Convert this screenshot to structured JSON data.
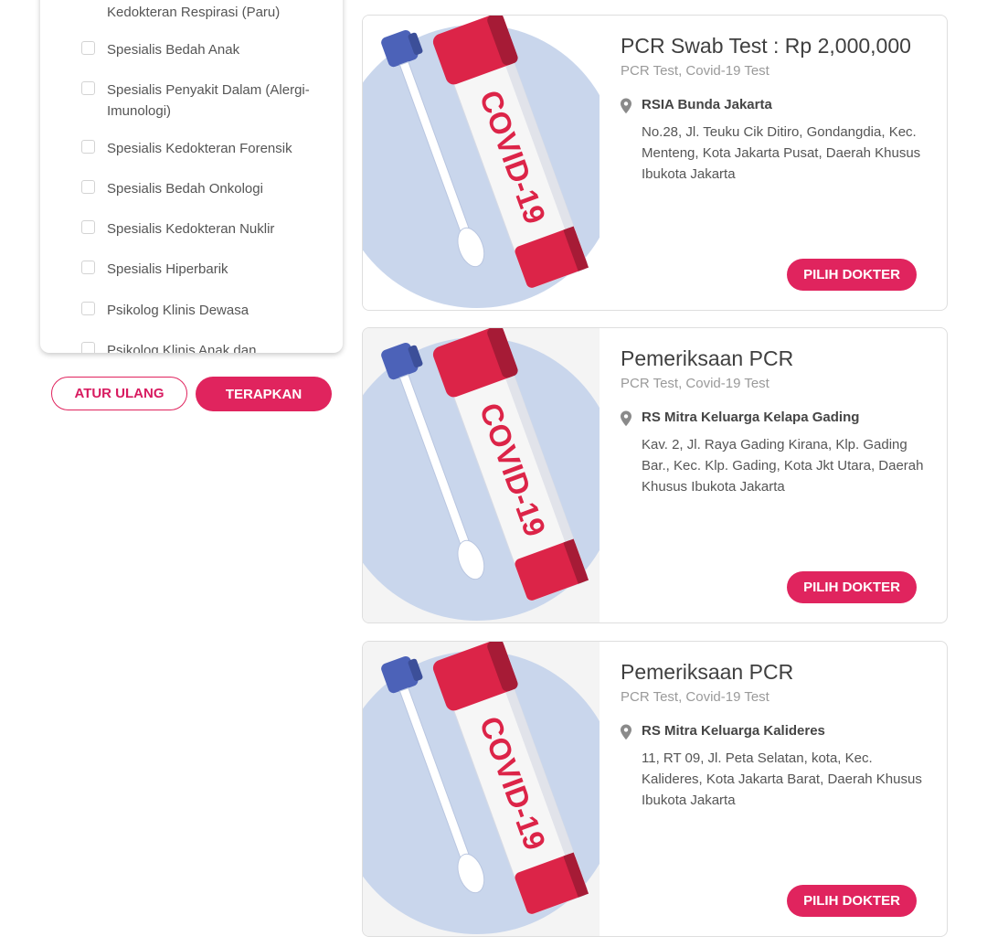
{
  "filters": {
    "specialties": [
      {
        "label": "Kedokteran Respirasi (Paru)",
        "checked": false
      },
      {
        "label": "Spesialis Bedah Anak",
        "checked": false
      },
      {
        "label": "Spesialis Penyakit Dalam (Alergi-Imunologi)",
        "checked": false
      },
      {
        "label": "Spesialis Kedokteran Forensik",
        "checked": false
      },
      {
        "label": "Spesialis Bedah Onkologi",
        "checked": false
      },
      {
        "label": "Spesialis Kedokteran Nuklir",
        "checked": false
      },
      {
        "label": "Spesialis Hiperbarik",
        "checked": false
      },
      {
        "label": "Psikolog Klinis Dewasa",
        "checked": false
      },
      {
        "label": "Psikolog Klinis Anak dan",
        "checked": false
      }
    ],
    "reset_label": "ATUR ULANG",
    "apply_label": "TERAPKAN"
  },
  "results": [
    {
      "title": "PCR Swab Test : Rp 2,000,000",
      "category": "PCR Test, Covid-19 Test",
      "hospital": "RSIA Bunda Jakarta",
      "address": "No.28, Jl. Teuku Cik Ditiro, Gondangdia, Kec. Menteng, Kota Jakarta Pusat, Daerah Khusus Ibukota Jakarta",
      "button_label": "PILIH DOKTER",
      "image_label": "COVID-19"
    },
    {
      "title": "Pemeriksaan PCR",
      "category": "PCR Test, Covid-19 Test",
      "hospital": "RS Mitra Keluarga Kelapa Gading",
      "address": "Kav. 2, Jl. Raya Gading Kirana, Klp. Gading Bar., Kec. Klp. Gading, Kota Jkt Utara, Daerah Khusus Ibukota Jakarta",
      "button_label": "PILIH DOKTER",
      "image_label": "COVID-19"
    },
    {
      "title": "Pemeriksaan PCR",
      "category": "PCR Test, Covid-19 Test",
      "hospital": "RS Mitra Keluarga Kalideres",
      "address": "11, RT 09, Jl. Peta Selatan, kota, Kec. Kalideres, Kota Jakarta Barat, Daerah Khusus Ibukota Jakarta",
      "button_label": "PILIH DOKTER",
      "image_label": "COVID-19"
    }
  ],
  "colors": {
    "accent": "#e0245e",
    "tube_red": "#dc2448",
    "swab_cap": "#4c62b8",
    "circle_bg": "#c9d6ec"
  },
  "icons": {
    "checkbox": "checkbox-icon",
    "location": "map-pin-icon",
    "thumbnail": "covid-test-tube-illustration"
  }
}
